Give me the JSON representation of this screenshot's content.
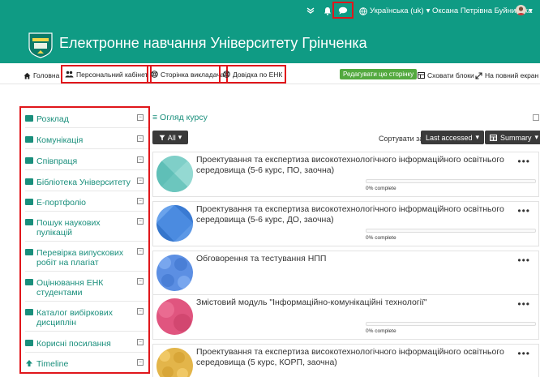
{
  "topbar": {
    "language": "Українська (uk)",
    "user_name": "Оксана Петрівна Буйницька"
  },
  "header": {
    "site_title": "Електронне навчання Університету Грінченка"
  },
  "nav": {
    "home": "Головна",
    "personal_cabinet": "Персональний кабінет",
    "teacher_page": "Сторінка викладача",
    "help": "Довідка по ЕНК",
    "edit_page": "Редагувати цю сторінку",
    "hide_blocks": "Сховати блоки",
    "fullscreen": "На повний екран"
  },
  "sidebar": {
    "items": [
      {
        "label": "Розклад"
      },
      {
        "label": "Комунікація"
      },
      {
        "label": "Співпраця"
      },
      {
        "label": "Бібліотека Університету"
      },
      {
        "label": "Е-портфоліо"
      },
      {
        "label": "Пошук наукових пулікацій"
      },
      {
        "label": "Перевірка випускових робіт на плагіат"
      },
      {
        "label": "Оцінювання ЕНК студентами"
      },
      {
        "label": "Каталог вибіркових дисциплін"
      },
      {
        "label": "Корисні посилання"
      },
      {
        "label": "Timeline"
      }
    ]
  },
  "main": {
    "title": "Огляд курсу",
    "filter_label": "All",
    "sort_label": "Сортувати за",
    "sort_value": "Last accessed",
    "view_value": "Summary",
    "courses": [
      {
        "title": "Проектування та експертиза високотехнологічного інформаційного освітнього середовища (5-6 курс, ПО, заочна)",
        "progress": "0% complete",
        "progress_value": 0
      },
      {
        "title": "Проектування та експертиза високотехнологічного інформаційного освітнього середовища (5-6 курс, ДО, заочна)",
        "progress": "0% complete",
        "progress_value": 0
      },
      {
        "title": "Обговорення та тестування НПП",
        "progress": "",
        "progress_value": null
      },
      {
        "title": "Змістовий модуль \"Інформаційно-комунікаційні технології\"",
        "progress": "0% complete",
        "progress_value": 0
      },
      {
        "title": "Проектування та експертиза високотехнологічного інформаційного освітнього середовища (5 курс, КОРП, заочна)",
        "progress": "",
        "progress_value": null
      }
    ]
  },
  "colors": {
    "brand": "#0f9b84",
    "accent_red": "#e0161b",
    "button_green": "#53a93f",
    "link": "#1a8f7c"
  },
  "icons": [
    "chevron-down-icon",
    "bell-icon",
    "chat-icon",
    "globe-icon",
    "home-icon",
    "users-icon",
    "lifebuoy-icon",
    "table-icon",
    "expand-icon",
    "filter-icon",
    "sort-icon",
    "menu-dots-icon"
  ]
}
